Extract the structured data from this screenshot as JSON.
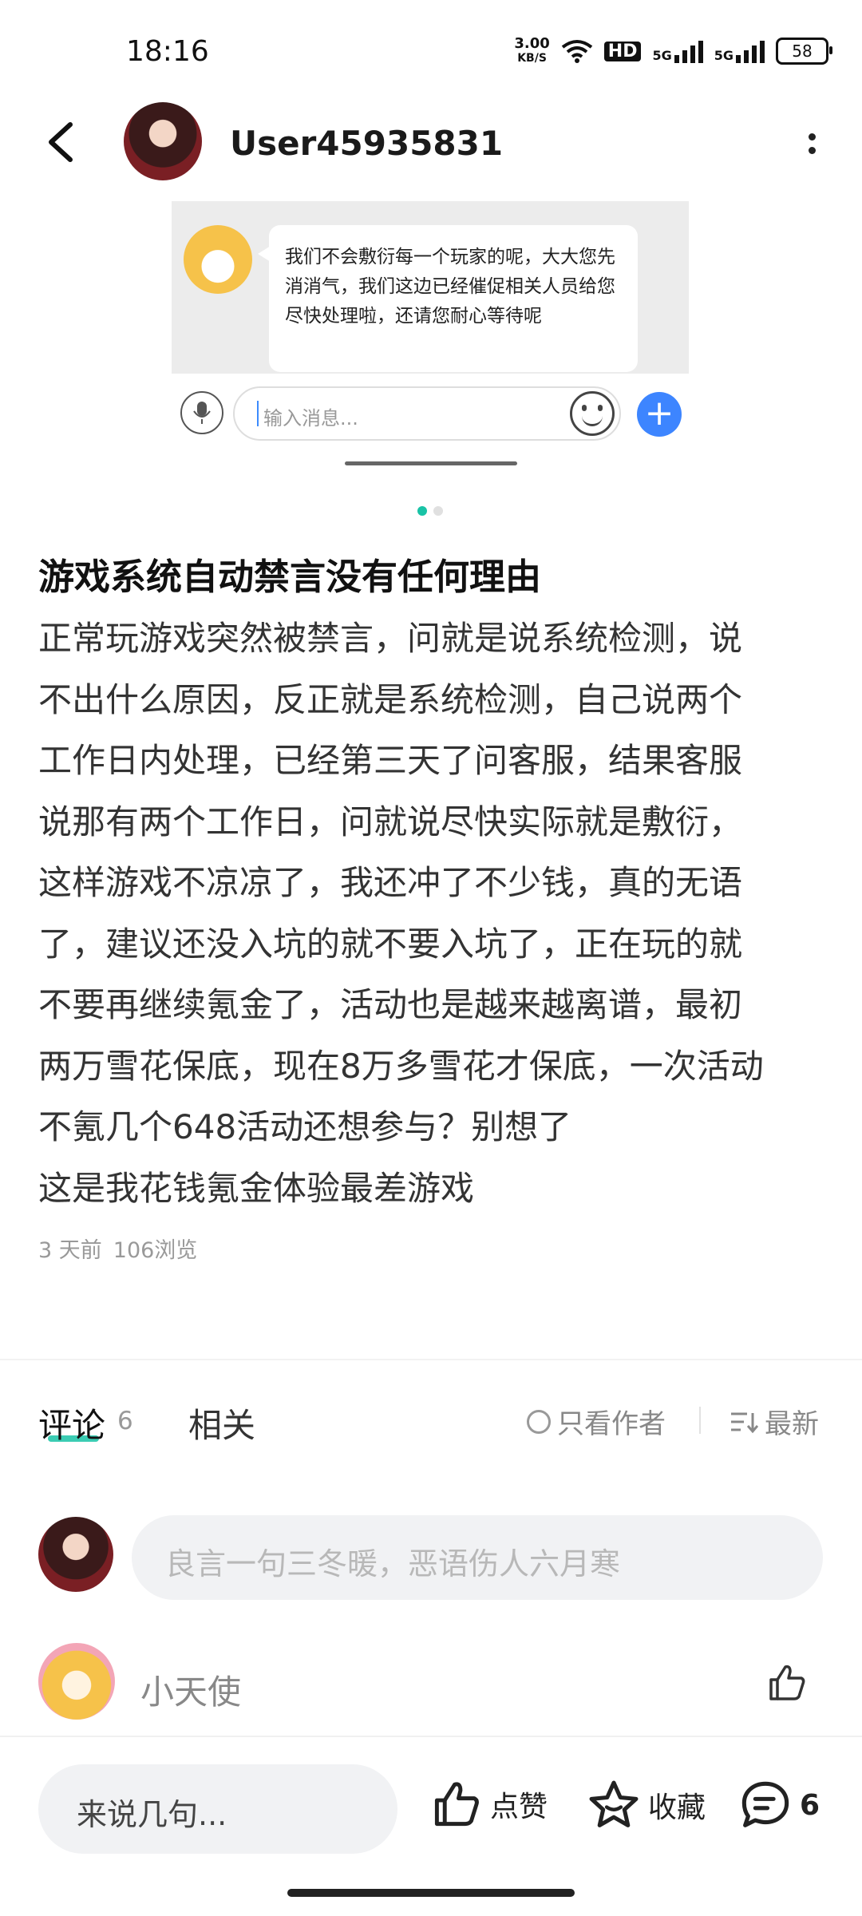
{
  "status_bar": {
    "time": "18:16",
    "net_speed_value": "3.00",
    "net_speed_unit": "KB/S",
    "hd_label": "HD",
    "signal1": "5G",
    "signal2": "5G",
    "battery": "58"
  },
  "header": {
    "username": "User45935831"
  },
  "screenshot": {
    "bubble_text": "我们不会敷衍每一个玩家的呢，大大您先消消气，我们这边已经催促相关人员给您尽快处理啦，还请您耐心等待呢",
    "input_placeholder": "输入消息..."
  },
  "post": {
    "title": "游戏系统自动禁言没有任何理由",
    "body_lines": [
      "正常玩游戏突然被禁言，问就是说系统检测，说",
      "不出什么原因，反正就是系统检测，自己说两个",
      "工作日内处理，已经第三天了问客服，结果客服",
      "说那有两个工作日，问就说尽快实际就是敷衍，",
      "这样游戏不凉凉了，我还冲了不少钱，真的无语",
      "了，建议还没入坑的就不要入坑了，正在玩的就",
      "不要再继续氪金了，活动也是越来越离谱，最初",
      "两万雪花保底，现在8万多雪花才保底，一次活动",
      "不氪几个648活动还想参与？别想了",
      "这是我花钱氪金体验最差游戏"
    ],
    "time_ago": "3 天前",
    "views": "106浏览"
  },
  "tabs": {
    "comments_label": "评论",
    "comments_count": "6",
    "related_label": "相关",
    "author_only": "只看作者",
    "sort_label": "最新"
  },
  "comment_input": {
    "placeholder": "良言一句三冬暖，恶语伤人六月寒"
  },
  "comments": [
    {
      "user": "小天使"
    }
  ],
  "bottom_bar": {
    "say_placeholder": "来说几句...",
    "like_label": "点赞",
    "favorite_label": "收藏",
    "comment_count": "6"
  },
  "colors": {
    "accent": "#19c3a6",
    "blue_button": "#3d85ff"
  }
}
